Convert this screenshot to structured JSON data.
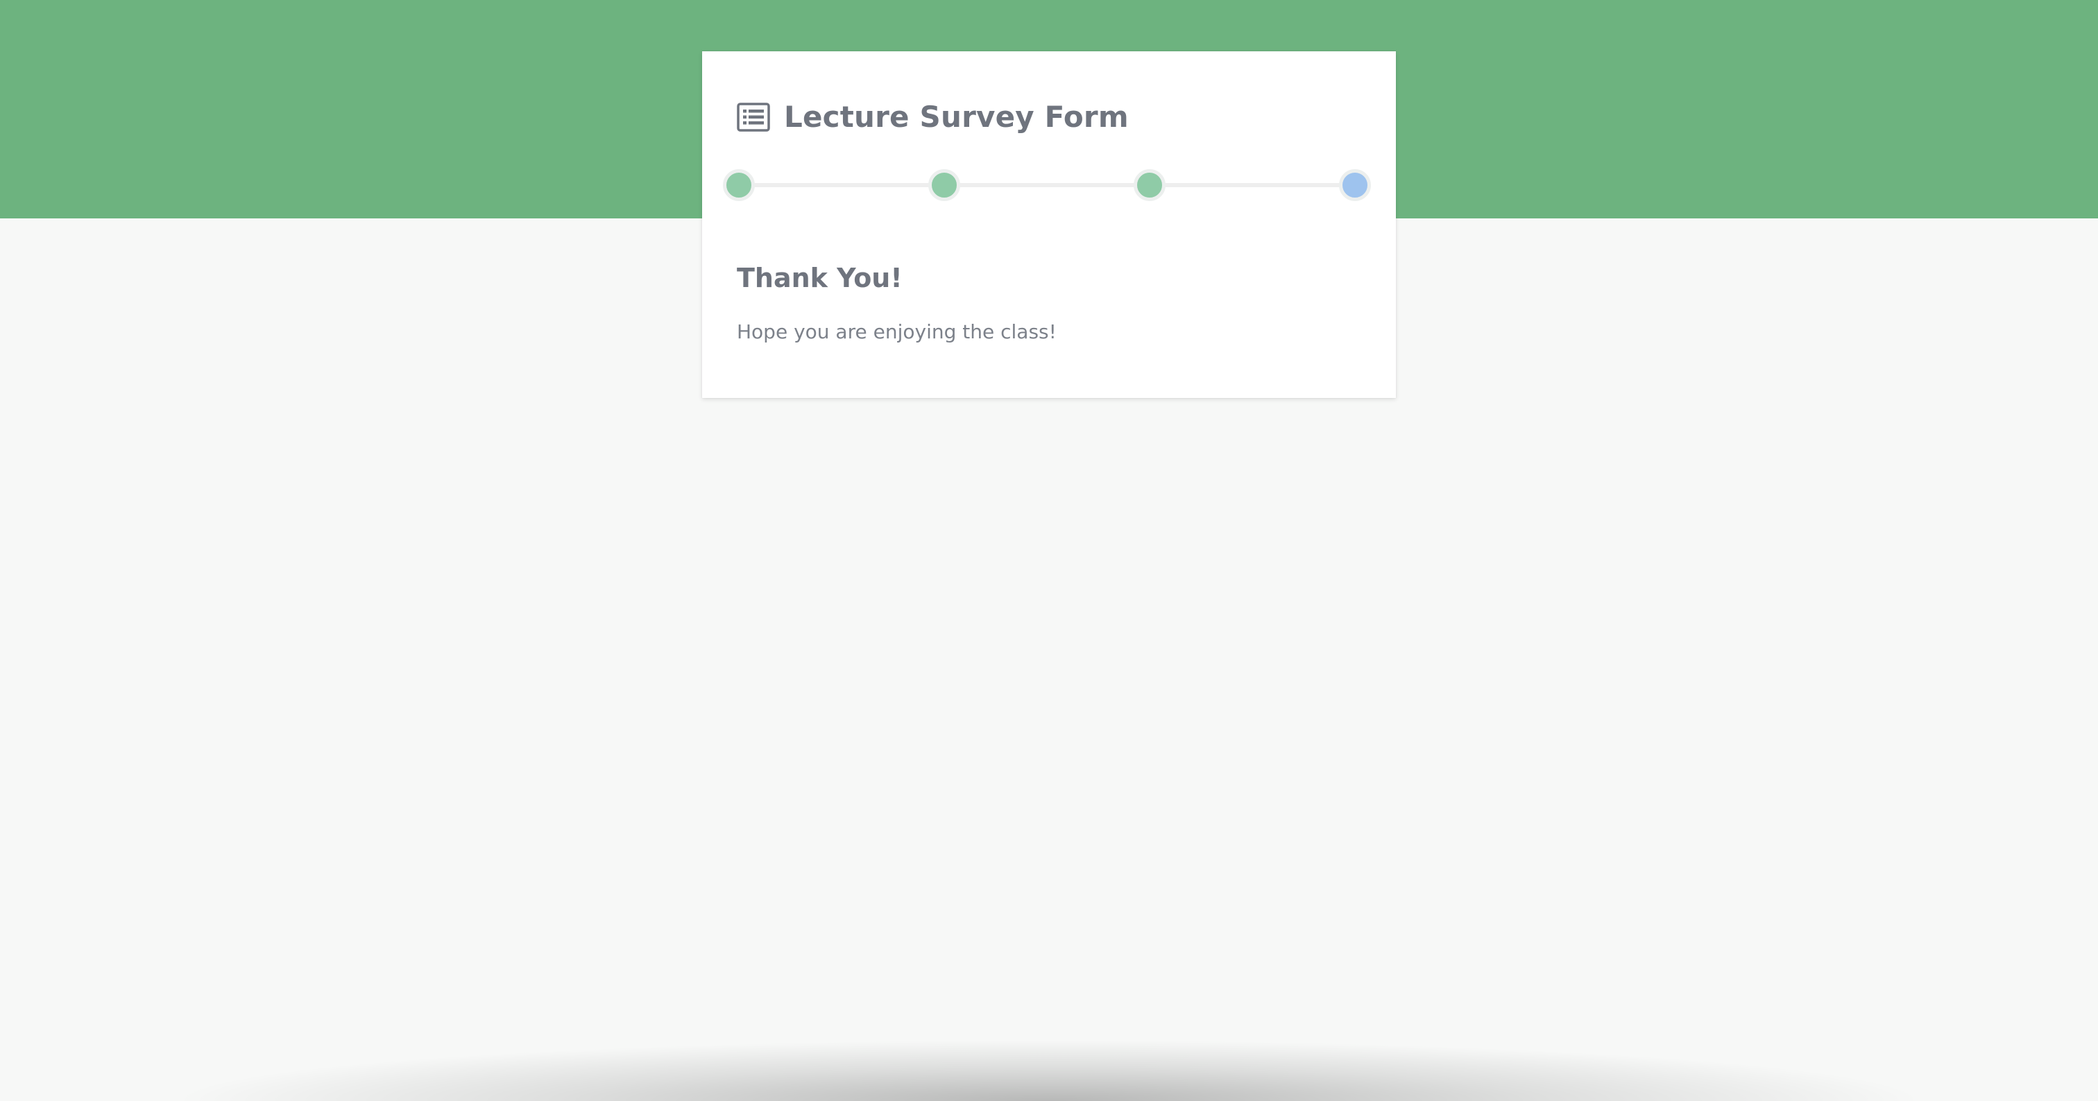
{
  "form": {
    "title": "Lecture Survey Form",
    "icon": "list-alt-icon"
  },
  "progress": {
    "total_steps": 4,
    "current_step": 4,
    "steps": [
      {
        "state": "completed",
        "color": "#8fcba7"
      },
      {
        "state": "completed",
        "color": "#8fcba7"
      },
      {
        "state": "completed",
        "color": "#8fcba7"
      },
      {
        "state": "current",
        "color": "#9ec3ee"
      }
    ]
  },
  "result": {
    "heading": "Thank You!",
    "message": "Hope you are enjoying the class!"
  },
  "colors": {
    "header_band": "#6db37f",
    "page_background": "#f7f8f7",
    "text": "#6f747e"
  }
}
